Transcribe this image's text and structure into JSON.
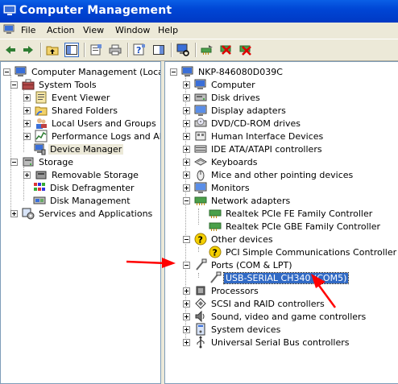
{
  "window": {
    "title": "Computer Management"
  },
  "menu": {
    "items": [
      "File",
      "Action",
      "View",
      "Window",
      "Help"
    ]
  },
  "toolbar": {
    "buttons": [
      "back-icon",
      "forward-icon",
      "up-folder-icon",
      "show-hide-tree-icon",
      "properties-icon",
      "print-icon",
      "help-icon",
      "show-hide-action-pane-icon",
      "scan-hardware-icon",
      "update-driver-icon",
      "uninstall-icon",
      "disable-device-icon"
    ]
  },
  "left_tree": {
    "root": "Computer Management (Local)",
    "system_tools": "System Tools",
    "event_viewer": "Event Viewer",
    "shared_folders": "Shared Folders",
    "local_users": "Local Users and Groups",
    "perf_logs": "Performance Logs and Alerts",
    "device_manager": "Device Manager",
    "storage": "Storage",
    "removable_storage": "Removable Storage",
    "disk_defrag": "Disk Defragmenter",
    "disk_mgmt": "Disk Management",
    "services": "Services and Applications"
  },
  "right_tree": {
    "root": "NKP-846080D039C",
    "items": [
      "Computer",
      "Disk drives",
      "Display adapters",
      "DVD/CD-ROM drives",
      "Human Interface Devices",
      "IDE ATA/ATAPI controllers",
      "Keyboards",
      "Mice and other pointing devices",
      "Monitors",
      "Network adapters"
    ],
    "net_children": [
      "Realtek PCIe FE Family Controller",
      "Realtek PCIe GBE Family Controller"
    ],
    "other_devices": "Other devices",
    "other_children": [
      "PCI Simple Communications Controller"
    ],
    "ports": "Ports (COM & LPT)",
    "ports_children": [
      "USB-SERIAL CH340 (COM5)"
    ],
    "after_ports": [
      "Processors",
      "SCSI and RAID controllers",
      "Sound, video and game controllers",
      "System devices",
      "Universal Serial Bus controllers"
    ]
  },
  "colors": {
    "title_bar": "#0046d5",
    "selection": "#316ac5",
    "annotation_arrow": "#ff0000"
  }
}
